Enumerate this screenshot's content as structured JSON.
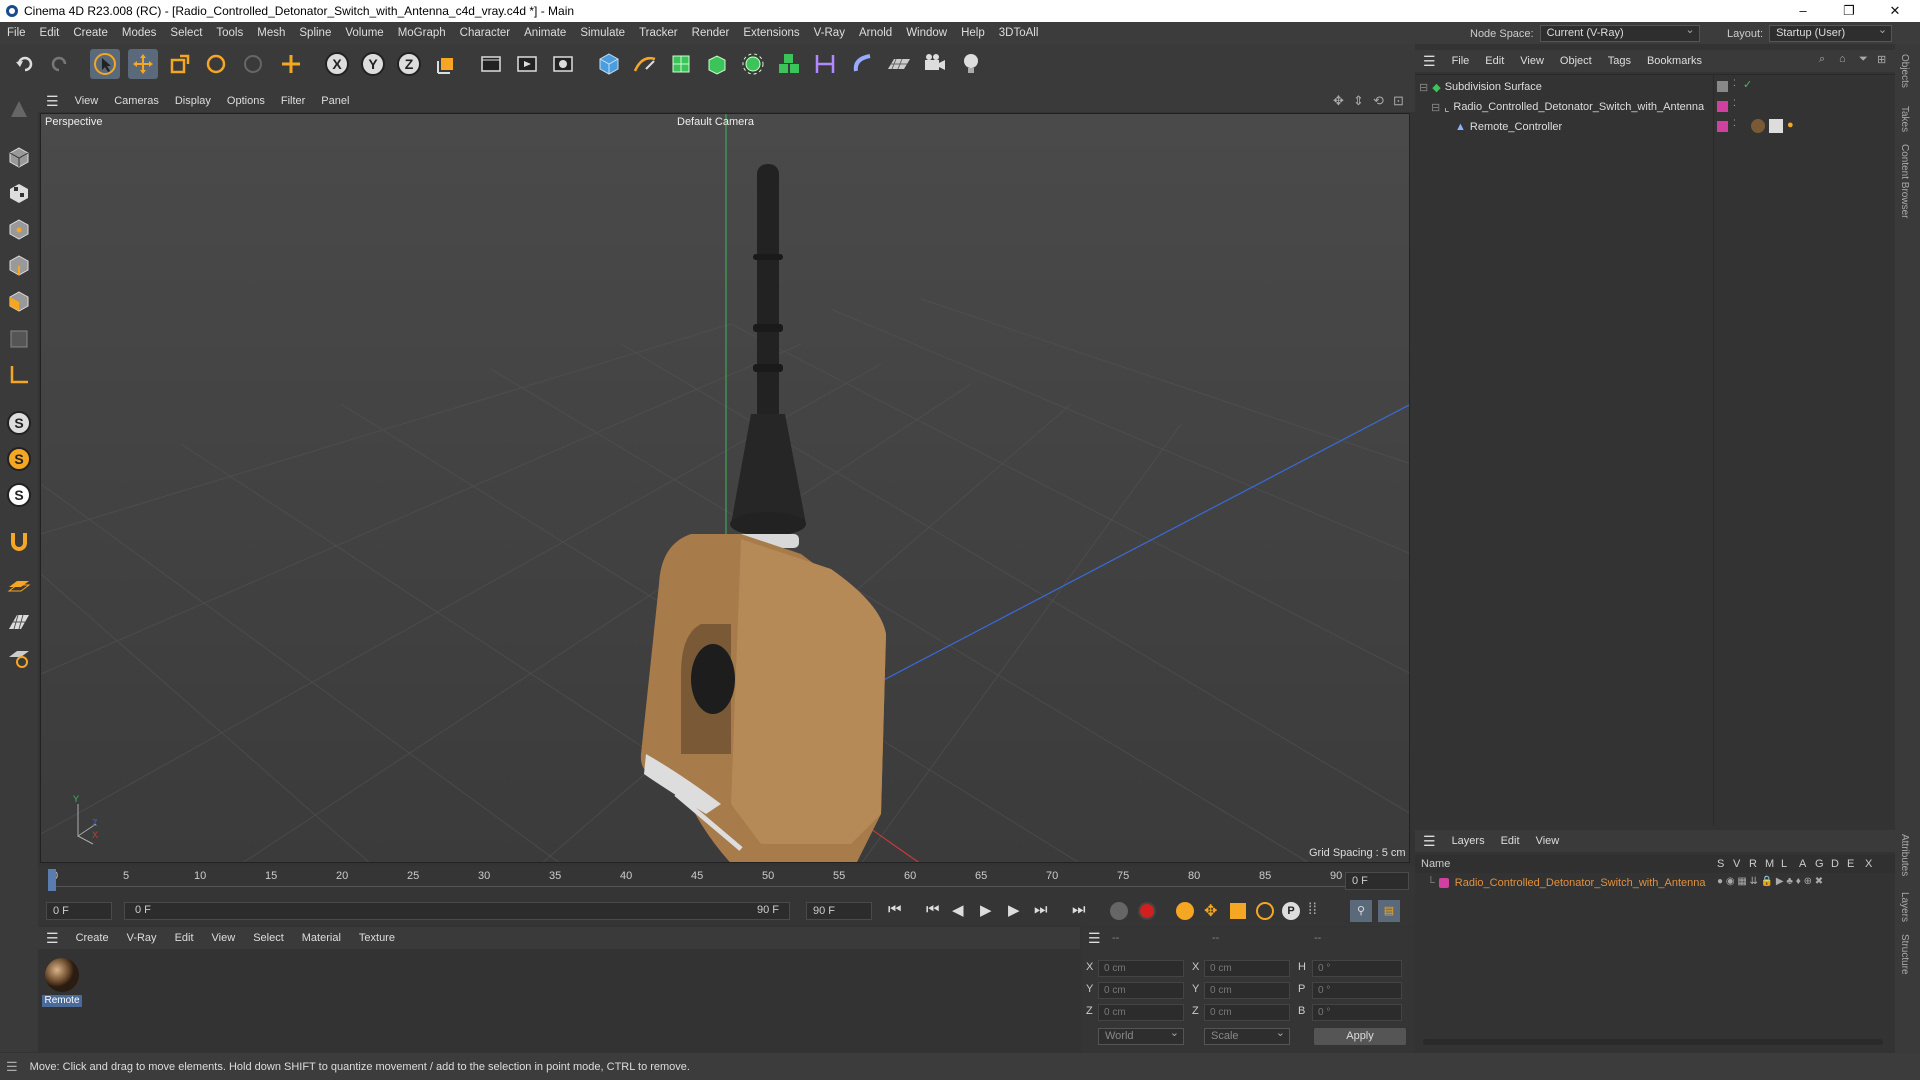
{
  "window": {
    "title": "Cinema 4D R23.008 (RC) - [Radio_Controlled_Detonator_Switch_with_Antenna_c4d_vray.c4d *] - Main",
    "controls": [
      "–",
      "❐",
      "✕"
    ]
  },
  "menubar": {
    "items": [
      "File",
      "Edit",
      "Create",
      "Modes",
      "Select",
      "Tools",
      "Mesh",
      "Spline",
      "Volume",
      "MoGraph",
      "Character",
      "Animate",
      "Simulate",
      "Tracker",
      "Render",
      "Extensions",
      "V-Ray",
      "Arnold",
      "Window",
      "Help",
      "3DToAll"
    ],
    "node_space_label": "Node Space:",
    "node_space_value": "Current (V-Ray)",
    "layout_label": "Layout:",
    "layout_value": "Startup (User)"
  },
  "toolbar": {
    "icons": [
      "undo-icon",
      "redo-icon",
      "select-pointer-icon",
      "move-icon",
      "scale-icon",
      "rotate-icon",
      "live-select-icon",
      "place-icon",
      "x-axis-icon",
      "y-axis-icon",
      "z-axis-icon",
      "coordinate-system-icon",
      "render-view-icon",
      "render-picture-viewer-icon",
      "render-settings-icon",
      "cube-icon",
      "pen-icon",
      "subdivision-icon",
      "extrude-icon",
      "cloner-icon",
      "mograph-icon",
      "deformer-icon",
      "sky-icon",
      "floor-icon",
      "camera-icon",
      "light-icon"
    ]
  },
  "left_tools": {
    "icons": [
      "make-editable-icon",
      "model-mode-icon",
      "texture-mode-icon",
      "points-mode-icon",
      "edges-mode-icon",
      "polygons-mode-icon",
      "uv-mode-icon",
      "axis-mode-icon",
      "snap-icon",
      "snap-settings-icon",
      "quantize-icon",
      "magnet-icon",
      "workplane-icon",
      "grid-icon",
      "solo-icon"
    ]
  },
  "viewport": {
    "menu": [
      "View",
      "Cameras",
      "Display",
      "Options",
      "Filter",
      "Panel"
    ],
    "label": "Perspective",
    "camera": "Default Camera",
    "grid_spacing": "Grid Spacing : 5 cm",
    "axis_y": "Y",
    "axis_z": "Z",
    "axis_x": "X"
  },
  "timeline": {
    "ticks": [
      "0",
      "5",
      "10",
      "15",
      "20",
      "25",
      "30",
      "35",
      "40",
      "45",
      "50",
      "55",
      "60",
      "65",
      "70",
      "75",
      "80",
      "85",
      "90"
    ],
    "current_frame": "0 F",
    "start_field": "0 F",
    "range_start": "0 F",
    "range_end": "90 F",
    "end_field": "90 F"
  },
  "material_manager": {
    "menu": [
      "Create",
      "V-Ray",
      "Edit",
      "View",
      "Select",
      "Material",
      "Texture"
    ],
    "materials": [
      {
        "name": "Remote"
      }
    ]
  },
  "coordinates": {
    "headers": [
      "--",
      "--",
      "--"
    ],
    "rows": [
      {
        "a": "X",
        "av": "0 cm",
        "b": "X",
        "bv": "0 cm",
        "c": "H",
        "cv": "0 °"
      },
      {
        "a": "Y",
        "av": "0 cm",
        "b": "Y",
        "bv": "0 cm",
        "c": "P",
        "cv": "0 °"
      },
      {
        "a": "Z",
        "av": "0 cm",
        "b": "Z",
        "bv": "0 cm",
        "c": "B",
        "cv": "0 °"
      }
    ],
    "space": "World",
    "mode": "Scale",
    "apply": "Apply"
  },
  "object_manager": {
    "menu": [
      "File",
      "Edit",
      "View",
      "Object",
      "Tags",
      "Bookmarks"
    ],
    "objects": [
      {
        "name": "Subdivision Surface",
        "indent": 0
      },
      {
        "name": "Radio_Controlled_Detonator_Switch_with_Antenna",
        "indent": 1
      },
      {
        "name": "Remote_Controller",
        "indent": 2
      }
    ]
  },
  "layers": {
    "menu": [
      "Layers",
      "Edit",
      "View"
    ],
    "columns": {
      "name": "Name",
      "flags": [
        "S",
        "V",
        "R",
        "M",
        "L",
        "A",
        "G",
        "D",
        "E",
        "X"
      ]
    },
    "items": [
      {
        "name": "Radio_Controlled_Detonator_Switch_with_Antenna",
        "color": "#d040a0"
      }
    ]
  },
  "side_tabs": [
    "Objects",
    "Takes",
    "Content Browser",
    "Attributes",
    "Layers",
    "Structure"
  ],
  "status": {
    "text": "Move: Click and drag to move elements. Hold down SHIFT to quantize movement / add to the selection in point mode, CTRL to remove."
  },
  "colors": {
    "accent": "#5a6a7a",
    "layer_text": "#e09040",
    "object_tag": "#d040a0"
  }
}
